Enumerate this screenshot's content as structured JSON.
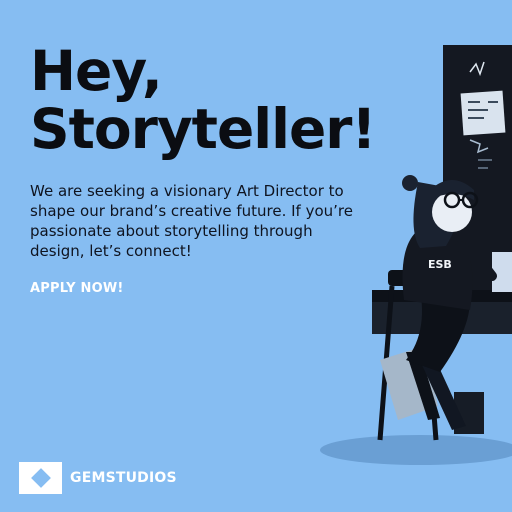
{
  "headline": {
    "line1": "Hey,",
    "line2": "Storyteller!"
  },
  "body": {
    "text": "We are seeking a visionary Art Director to shape our brand’s creative future. If you’re passionate about storytelling through design, let’s connect!"
  },
  "cta": {
    "label": "APPLY NOW!"
  },
  "logo": {
    "name": "GEMSTUDIOS",
    "icon": "diamond-icon"
  },
  "illustration": {
    "shirt_text": "ESB"
  },
  "colors": {
    "background": "#86bdf2",
    "headline": "#0b0d12",
    "dark": "#141821",
    "white": "#ffffff"
  }
}
